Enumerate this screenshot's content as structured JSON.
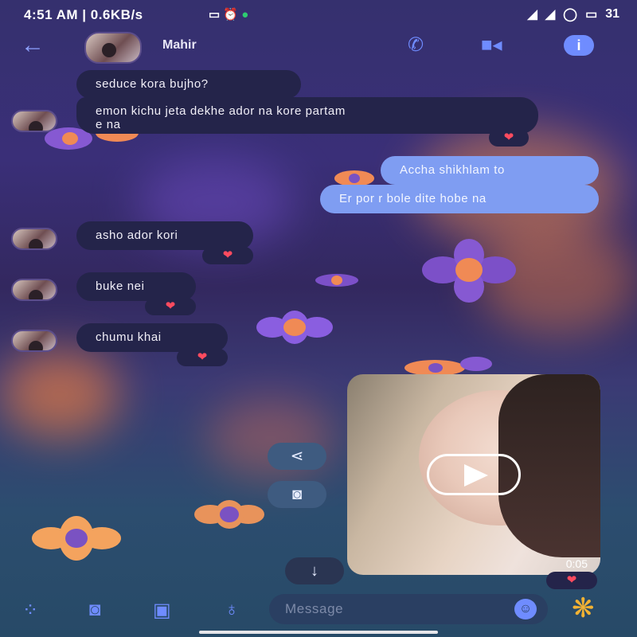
{
  "status_bar": {
    "time": "4:51 AM | 0.6KB/s",
    "battery": "31"
  },
  "header": {
    "contact_name": "Mahir",
    "back_icon": "arrow-left-icon",
    "call_icon": "phone-icon",
    "video_icon": "video-camera-icon",
    "info_icon": "info-icon"
  },
  "messages": {
    "m1": "seduce kora bujho?",
    "m2_line1": "emon kichu jeta dekhe ador na kore partam",
    "m2_line2": "e na",
    "s1": "Accha shikhlam to",
    "s2": "Er por r bole dite hobe na",
    "m3": "asho ador kori",
    "m4": "buke nei",
    "m5": "chumu khai",
    "reaction": "❤"
  },
  "video": {
    "duration": "0:05"
  },
  "composer": {
    "placeholder": "Message"
  },
  "colors": {
    "accent": "#6f8cff",
    "received_bubble": "#24244a",
    "sent_bubble": "#7f9df2",
    "heart": "#ff4b5f"
  }
}
